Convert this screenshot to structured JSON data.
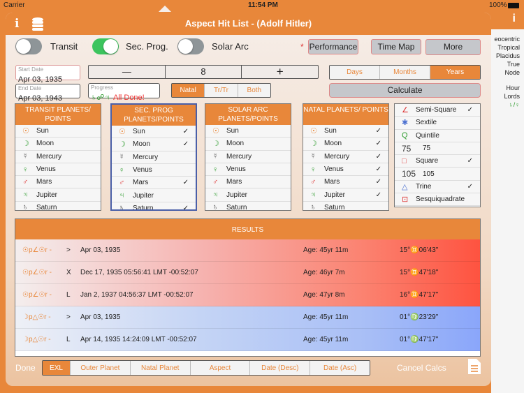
{
  "status": {
    "carrier": "Carrier",
    "time": "11:54 PM",
    "battery": "100%"
  },
  "background": {
    "lines": [
      "eocentric",
      "Tropical",
      "Placidus",
      "True Node"
    ],
    "hour_lords": "Hour Lords",
    "hour_lords_value": "♄/♀",
    "info": "i"
  },
  "header": {
    "title": "Aspect Hit List - (Adolf Hitler)",
    "info_icon": "i"
  },
  "toggles": [
    {
      "label": "Transit",
      "on": false
    },
    {
      "label": "Sec. Prog.",
      "on": true
    },
    {
      "label": "Solar Arc",
      "on": false
    }
  ],
  "buttons": {
    "asterisk": "*",
    "performance": "Performance",
    "time_map": "Time Map",
    "more": "More",
    "calculate": "Calculate"
  },
  "start_date": {
    "label": "Start Date",
    "value": "Apr 03, 1935"
  },
  "end_date": {
    "label": "End Date",
    "value": "Apr 03, 1943"
  },
  "stepper": {
    "minus": "—",
    "value": "8",
    "plus": "+"
  },
  "progress": {
    "label": "Progress",
    "glyphs": "♄☍♃",
    "text": "All Done!"
  },
  "mode_segment": [
    "Natal",
    "Tr/Tr",
    "Both"
  ],
  "unit_segment": [
    "Days",
    "Months",
    "Years"
  ],
  "tables": [
    {
      "title": "TRANSIT PLANETS/ POINTS",
      "rows": [
        {
          "g": "☉",
          "n": "Sun",
          "c": ""
        },
        {
          "g": "☽",
          "n": "Moon",
          "c": ""
        },
        {
          "g": "☿",
          "n": "Mercury",
          "c": ""
        },
        {
          "g": "♀",
          "n": "Venus",
          "c": ""
        },
        {
          "g": "♂",
          "n": "Mars",
          "c": ""
        },
        {
          "g": "♃",
          "n": "Jupiter",
          "c": ""
        },
        {
          "g": "♄",
          "n": "Saturn",
          "c": ""
        }
      ]
    },
    {
      "title": "SEC. PROG PLANETS/POINTS",
      "rows": [
        {
          "g": "☉",
          "n": "Sun",
          "c": "✓"
        },
        {
          "g": "☽",
          "n": "Moon",
          "c": "✓"
        },
        {
          "g": "☿",
          "n": "Mercury",
          "c": ""
        },
        {
          "g": "♀",
          "n": "Venus",
          "c": ""
        },
        {
          "g": "♂",
          "n": "Mars",
          "c": "✓"
        },
        {
          "g": "♃",
          "n": "Jupiter",
          "c": ""
        },
        {
          "g": "♄",
          "n": "Saturn",
          "c": "✓"
        }
      ]
    },
    {
      "title": "SOLAR ARC PLANETS/POINTS",
      "rows": [
        {
          "g": "☉",
          "n": "Sun",
          "c": ""
        },
        {
          "g": "☽",
          "n": "Moon",
          "c": ""
        },
        {
          "g": "☿",
          "n": "Mercury",
          "c": ""
        },
        {
          "g": "♀",
          "n": "Venus",
          "c": ""
        },
        {
          "g": "♂",
          "n": "Mars",
          "c": ""
        },
        {
          "g": "♃",
          "n": "Jupiter",
          "c": ""
        },
        {
          "g": "♄",
          "n": "Saturn",
          "c": ""
        }
      ]
    },
    {
      "title": "NATAL PLANETS/ POINTS",
      "rows": [
        {
          "g": "☉",
          "n": "Sun",
          "c": "✓"
        },
        {
          "g": "☽",
          "n": "Moon",
          "c": "✓"
        },
        {
          "g": "☿",
          "n": "Mercury",
          "c": "✓"
        },
        {
          "g": "♀",
          "n": "Venus",
          "c": "✓"
        },
        {
          "g": "♂",
          "n": "Mars",
          "c": "✓"
        },
        {
          "g": "♃",
          "n": "Jupiter",
          "c": "✓"
        },
        {
          "g": "♄",
          "n": "Saturn",
          "c": ""
        }
      ]
    }
  ],
  "glyph_colors": {
    "☉": "#e8873a",
    "☽": "#2a9a2a",
    "☿": "#555",
    "♀": "#2a9a2a",
    "♂": "#d33",
    "♃": "#2a9a2a",
    "♄": "#333"
  },
  "aspects": [
    {
      "g": "∠",
      "n": "Semi-Square",
      "c": "✓",
      "col": "#d33"
    },
    {
      "g": "✱",
      "n": "Sextile",
      "c": "",
      "col": "#4a6fd0"
    },
    {
      "g": "Q",
      "n": "Quintile",
      "c": "",
      "col": "#2a9a2a"
    },
    {
      "g": "75",
      "n": "75",
      "c": "",
      "col": "#333"
    },
    {
      "g": "□",
      "n": "Square",
      "c": "✓",
      "col": "#d33"
    },
    {
      "g": "105",
      "n": "105",
      "c": "",
      "col": "#333"
    },
    {
      "g": "△",
      "n": "Trine",
      "c": "✓",
      "col": "#4a6fd0"
    },
    {
      "g": "⊡",
      "n": "Sesquiquadrate",
      "c": "",
      "col": "#d33"
    }
  ],
  "results": {
    "title": "RESULTS",
    "rows": [
      {
        "aspect": "☉p∠☉r -",
        "type": ">",
        "date": "Apr 03, 1935",
        "age": "Age: 45yr 11m",
        "pos": "15°♊06'43\"",
        "tone": "red"
      },
      {
        "aspect": "☉p∠☉r -",
        "type": "X",
        "date": "Dec 17, 1935 05:56:41 LMT -00:52:07",
        "age": "Age: 46yr 7m",
        "pos": "15°♊47'18\"",
        "tone": "red"
      },
      {
        "aspect": "☉p∠☉r -",
        "type": "L",
        "date": "Jan 2, 1937 04:56:37 LMT -00:52:07",
        "age": "Age: 47yr 8m",
        "pos": "16°♊47'17\"",
        "tone": "red"
      },
      {
        "aspect": "☽p△☉r -",
        "type": ">",
        "date": "Apr 03, 1935",
        "age": "Age: 45yr 11m",
        "pos": "01°♍23'29\"",
        "tone": "blue"
      },
      {
        "aspect": "☽p△☉r -",
        "type": "L",
        "date": "Apr 14, 1935 14:24:09 LMT -00:52:07",
        "age": "Age: 45yr 11m",
        "pos": "01°♍47'17\"",
        "tone": "blue"
      }
    ]
  },
  "bottom": {
    "done": "Done",
    "sort": [
      "EXL",
      "Outer Planet",
      "Natal Planet",
      "Aspect",
      "Date (Desc)",
      "Date (Asc)"
    ],
    "cancel": "Cancel Calcs"
  }
}
